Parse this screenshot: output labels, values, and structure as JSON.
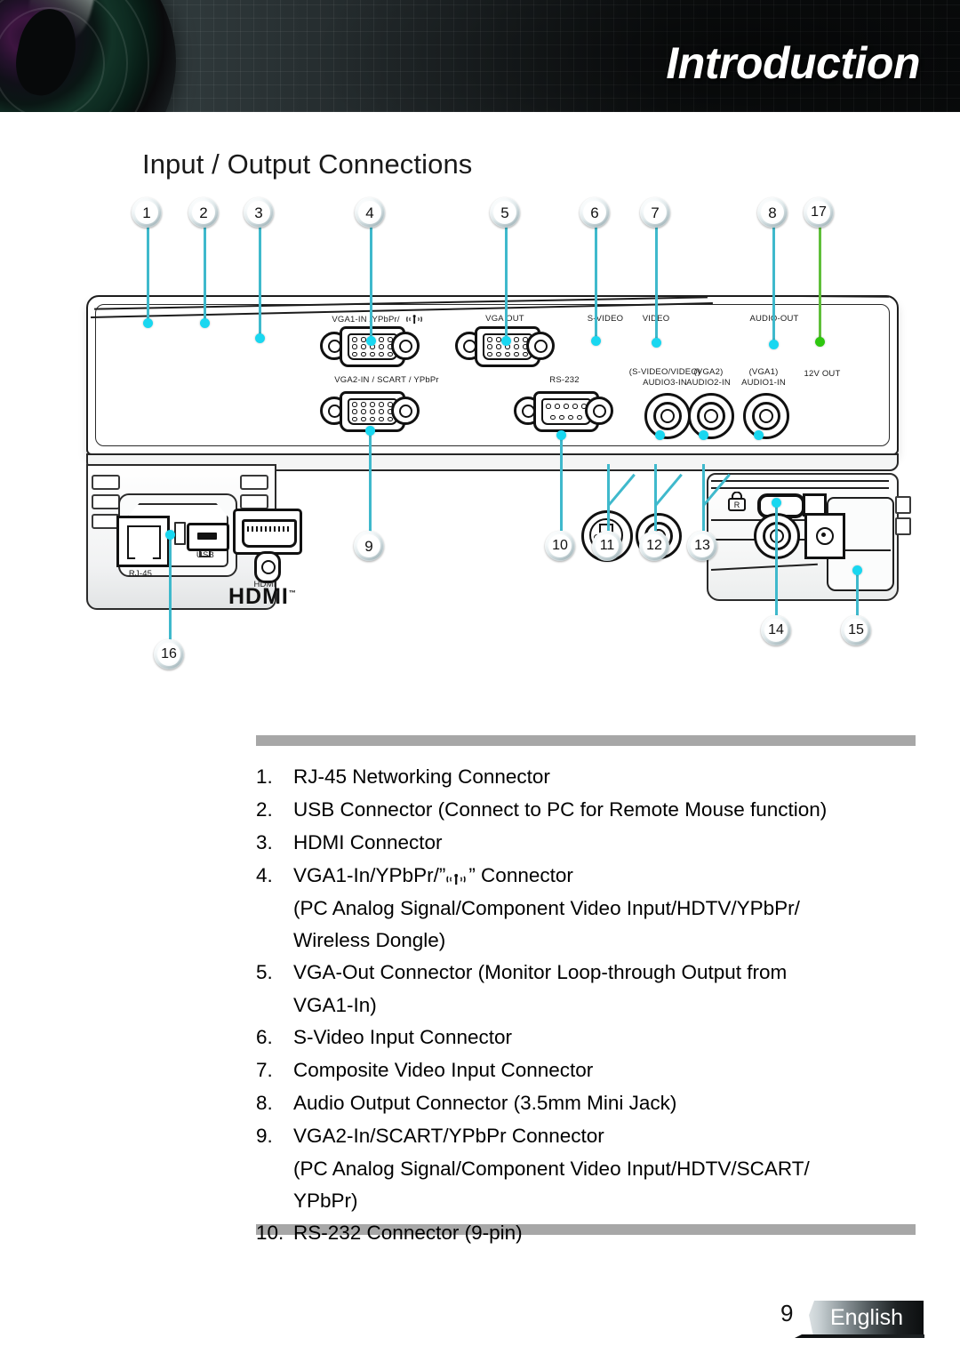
{
  "header": {
    "title": "Introduction",
    "lens_icon": "camera-lens-icon"
  },
  "section": {
    "title": "Input / Output Connections"
  },
  "diagram": {
    "callouts": [
      {
        "id": "1",
        "label": "1"
      },
      {
        "id": "2",
        "label": "2"
      },
      {
        "id": "3",
        "label": "3"
      },
      {
        "id": "4",
        "label": "4"
      },
      {
        "id": "5",
        "label": "5"
      },
      {
        "id": "6",
        "label": "6"
      },
      {
        "id": "7",
        "label": "7"
      },
      {
        "id": "8",
        "label": "8"
      },
      {
        "id": "17",
        "label": "17"
      },
      {
        "id": "9",
        "label": "9"
      },
      {
        "id": "10",
        "label": "10"
      },
      {
        "id": "11",
        "label": "11"
      },
      {
        "id": "12",
        "label": "12"
      },
      {
        "id": "13",
        "label": "13"
      },
      {
        "id": "14",
        "label": "14"
      },
      {
        "id": "15",
        "label": "15"
      },
      {
        "id": "16",
        "label": "16"
      }
    ],
    "port_labels": {
      "rj45": "RJ-45",
      "usb": "USB",
      "hdmi": "HDMI",
      "hdmi_logo": "HDMI",
      "hdmi_logo_tm": "™",
      "vga1_in": "VGA1-IN /YPbPr/",
      "vga_out": "VGA OUT",
      "s_video": "S-VIDEO",
      "video": "VIDEO",
      "audio_out": "AUDIO-OUT",
      "twelve_v_out": "12V OUT",
      "vga2_in": "VGA2-IN / SCART / YPbPr",
      "rs232": "RS-232",
      "audio3_in_top": "(S-VIDEO/VIDEO)",
      "audio3_in": "AUDIO3-IN",
      "audio2_in_top": "(VGA2)",
      "audio2_in": "AUDIO2-IN",
      "audio1_in_top": "(VGA1)",
      "audio1_in": "AUDIO1-IN"
    },
    "colors": {
      "leader_cyan": "#3fb9cc",
      "leader_green": "#5fbf3a",
      "dot_cyan": "#19d7f0",
      "dot_green": "#2ec70f"
    }
  },
  "list": {
    "items": [
      {
        "num": "1.",
        "text": "RJ-45 Networking Connector",
        "cont": []
      },
      {
        "num": "2.",
        "text": "USB Connector (Connect to PC for Remote Mouse function)",
        "cont": []
      },
      {
        "num": "3.",
        "text": "HDMI Connector",
        "cont": []
      },
      {
        "num": "4.",
        "text_pre": "VGA1-In/YPbPr/”",
        "text_post": "” Connector",
        "cont": [
          "(PC Analog Signal/Component Video Input/HDTV/YPbPr/",
          "Wireless Dongle)"
        ]
      },
      {
        "num": "5.",
        "text": "VGA-Out Connector (Monitor Loop-through Output from",
        "cont": [
          "VGA1-In)"
        ]
      },
      {
        "num": "6.",
        "text": "S-Video Input Connector",
        "cont": []
      },
      {
        "num": "7.",
        "text": "Composite Video Input Connector",
        "cont": []
      },
      {
        "num": "8.",
        "text": "Audio Output Connector (3.5mm Mini Jack)",
        "cont": []
      },
      {
        "num": "9.",
        "text": "VGA2-In/SCART/YPbPr Connector",
        "cont": [
          "(PC Analog Signal/Component Video Input/HDTV/SCART/",
          "YPbPr)"
        ]
      },
      {
        "num": "10.",
        "text": "RS-232 Connector (9-pin)",
        "cont": []
      }
    ]
  },
  "footer": {
    "page_number": "9",
    "language": "English"
  }
}
